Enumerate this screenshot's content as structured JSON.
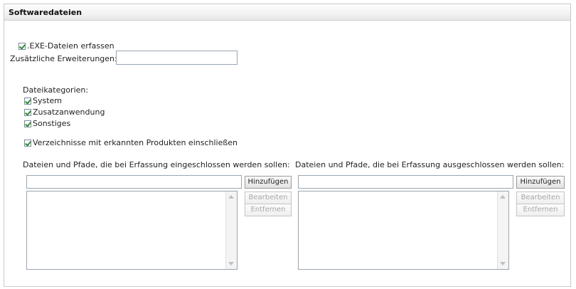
{
  "panel": {
    "title": "Softwaredateien"
  },
  "exe": {
    "label": ".EXE-Dateien erfassen",
    "checked": true
  },
  "extensions": {
    "label": "Zusätzliche Erweiterungen:",
    "value": ""
  },
  "categories": {
    "label": "Dateikategorien:",
    "items": [
      {
        "label": "System",
        "checked": true
      },
      {
        "label": "Zusatzanwendung",
        "checked": true
      },
      {
        "label": "Sonstiges",
        "checked": true
      }
    ]
  },
  "directories": {
    "label": "Verzeichnisse mit erkannten Produkten einschließen",
    "checked": true
  },
  "include": {
    "label": "Dateien und Pfade, die bei Erfassung eingeschlossen werden sollen:",
    "input_value": "",
    "add_label": "Hinzufügen",
    "edit_label": "Bearbeiten",
    "remove_label": "Entfernen",
    "items": []
  },
  "exclude": {
    "label": "Dateien und Pfade, die bei Erfassung ausgeschlossen werden sollen:",
    "input_value": "",
    "add_label": "Hinzufügen",
    "edit_label": "Bearbeiten",
    "remove_label": "Entfernen",
    "items": []
  }
}
